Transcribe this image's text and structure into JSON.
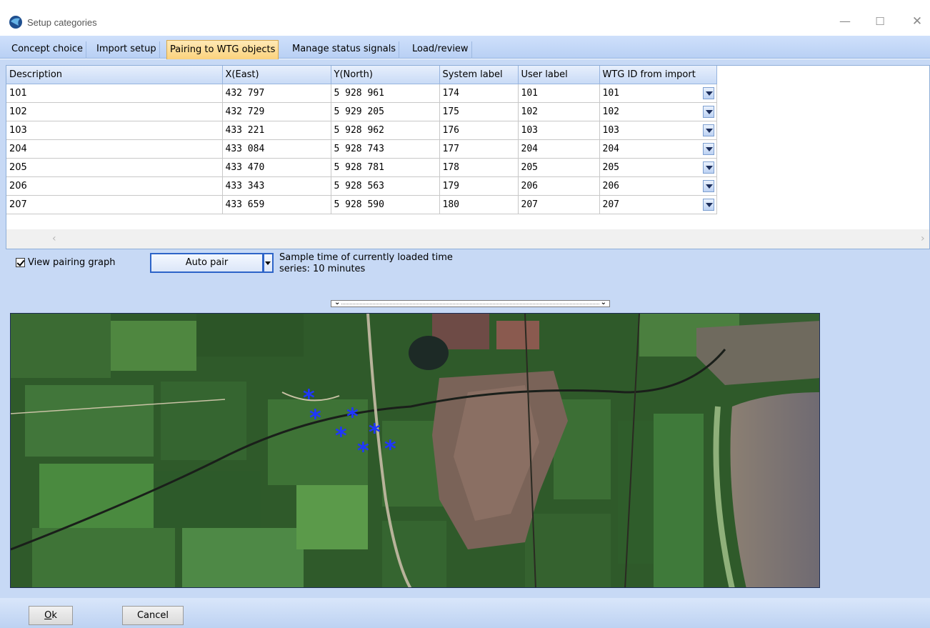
{
  "window": {
    "title": "Setup categories",
    "minimize": "—",
    "maximize": "☐",
    "close": "✕"
  },
  "tabs": [
    {
      "label": "Concept choice",
      "active": false
    },
    {
      "label": "Import setup",
      "active": false
    },
    {
      "label": "Pairing to WTG objects",
      "active": true
    },
    {
      "label": "Manage status signals",
      "active": false
    },
    {
      "label": "Load/review",
      "active": false
    }
  ],
  "grid": {
    "columns": [
      "Description",
      "X(East)",
      "Y(North)",
      "System label",
      "User label",
      "WTG ID from import"
    ],
    "rows": [
      [
        "101",
        "432 797",
        "5 928 961",
        "174",
        "101",
        "101"
      ],
      [
        "102",
        "432 729",
        "5 929 205",
        "175",
        "102",
        "102"
      ],
      [
        "103",
        "433 221",
        "5 928 962",
        "176",
        "103",
        "103"
      ],
      [
        "204",
        "433 084",
        "5 928 743",
        "177",
        "204",
        "204"
      ],
      [
        "205",
        "433 470",
        "5 928 781",
        "178",
        "205",
        "205"
      ],
      [
        "206",
        "433 343",
        "5 928 563",
        "179",
        "206",
        "206"
      ],
      [
        "207",
        "433 659",
        "5 928 590",
        "180",
        "207",
        "207"
      ]
    ]
  },
  "controls": {
    "view_pairing_graph_label": "View pairing graph",
    "view_pairing_graph_checked": true,
    "auto_pair_label": "Auto pair",
    "sample_time_text_line1": "Sample time of currently loaded time",
    "sample_time_text_line2": "series: 10 minutes"
  },
  "map": {
    "turbine_marker": "*",
    "turbine_color": "#1f36ff"
  },
  "footer": {
    "ok_label": "k",
    "ok_mnemonic": "O",
    "cancel_label": "Cancel"
  },
  "colors": {
    "tab_active": "#fbd27d",
    "panel_bg": "#c7d9f5",
    "focus_border": "#2d64c8"
  }
}
